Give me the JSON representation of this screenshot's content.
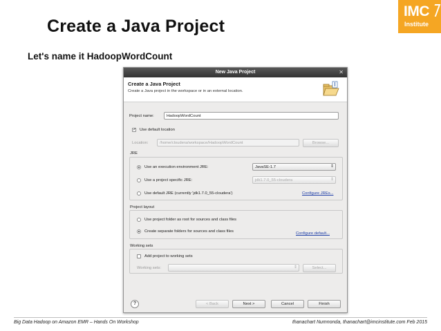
{
  "slide": {
    "title": "Create a Java Project",
    "subtitle": "Let's name it HadoopWordCount",
    "logo_text": "IMC",
    "logo_sub": "Institute",
    "footer_left": "Big Data Hadoop on Amazon EMR – Hands On Workshop",
    "footer_right": "thanachart Numnonda,  thanachart@imcinstitute.com   Feb 2015",
    "accent_color": "#f5a623"
  },
  "dialog": {
    "window_title": "New Java Project",
    "close_glyph": "✕",
    "header": "Create a Java Project",
    "description": "Create a Java project in the workspace or in an external location.",
    "project_name_label": "Project name:",
    "project_name_value": "HadoopWordCount",
    "use_default_location": "Use default location",
    "location_label": "Location:",
    "location_value": "/home/cloudera/workspace/HadoopWordCount",
    "browse": "Browse...",
    "jre": {
      "title": "JRE",
      "opt_env": "Use an execution environment JRE:",
      "env_value": "JavaSE-1.7",
      "opt_specific": "Use a project specific JRE:",
      "specific_value": "jdk1.7.0_55-cloudera",
      "opt_default": "Use default JRE (currently 'jdk1.7.0_55-cloudera')",
      "configure": "Configure JREs..."
    },
    "layout": {
      "title": "Project layout",
      "opt_root": "Use project folder as root for sources and class files",
      "opt_separate": "Create separate folders for sources and class files",
      "configure": "Configure default..."
    },
    "working_sets": {
      "title": "Working sets",
      "add": "Add project to working sets",
      "label": "Working sets:",
      "select": "Select..."
    },
    "buttons": {
      "help": "?",
      "back": "< Back",
      "next": "Next >",
      "cancel": "Cancel",
      "finish": "Finish"
    }
  }
}
